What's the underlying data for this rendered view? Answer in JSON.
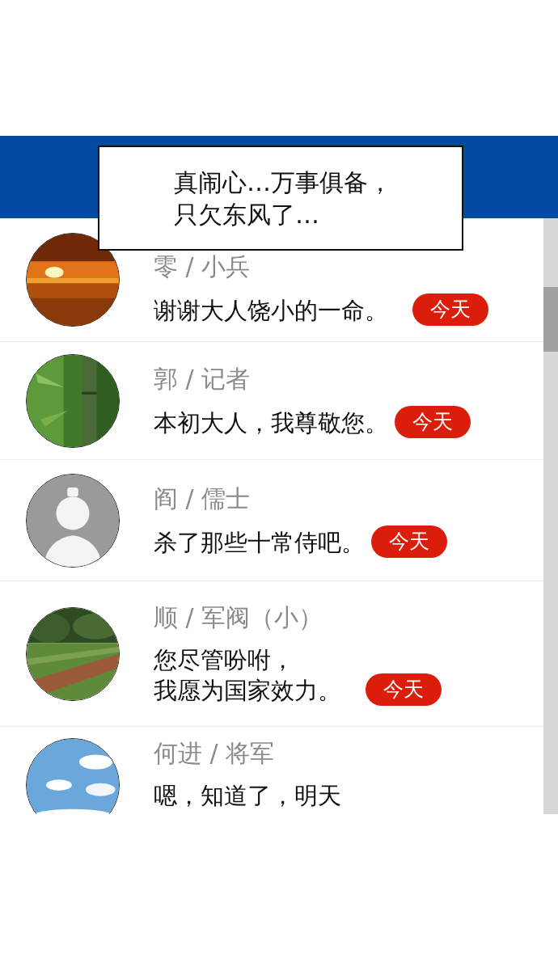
{
  "caption": [
    "真闹心…万事俱备，",
    "只欠东风了…"
  ],
  "chats": [
    {
      "avatar": {
        "kind": "sunset"
      },
      "name": "零 / 小兵",
      "message": "谢谢大人饶小的一命。",
      "badge": "今天"
    },
    {
      "avatar": {
        "kind": "bamboo"
      },
      "name": "郭 / 记者",
      "message": "本初大人，我尊敬您。",
      "badge": "今天"
    },
    {
      "avatar": {
        "kind": "figure"
      },
      "name": "阎 / 儒士",
      "message": "杀了那些十常侍吧。",
      "badge": "今天"
    },
    {
      "avatar": {
        "kind": "field"
      },
      "name": "顺 / 军阀（小）",
      "message": [
        "您尽管吩咐，",
        "我愿为国家效力。"
      ],
      "badge": "今天"
    },
    {
      "avatar": {
        "kind": "sky"
      },
      "name": "何进 / 将军",
      "message": "嗯，知道了，明天"
    }
  ]
}
